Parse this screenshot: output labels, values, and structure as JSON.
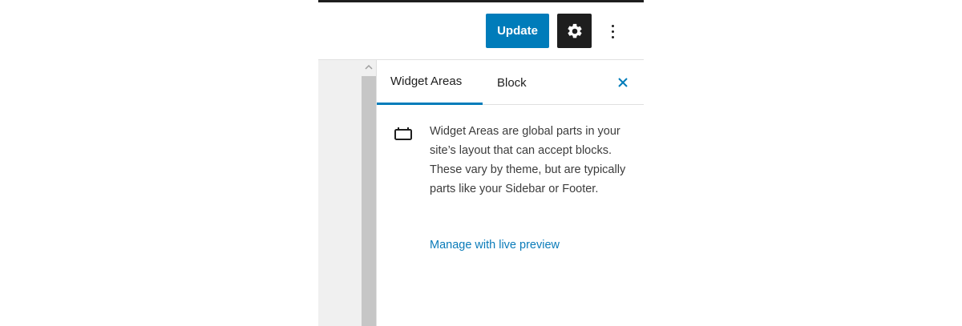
{
  "header": {
    "update_label": "Update",
    "settings_icon": "gear-icon",
    "more_icon": "more-vertical-icon"
  },
  "sidebar": {
    "tabs": [
      {
        "label": "Widget Areas",
        "active": true
      },
      {
        "label": "Block",
        "active": false
      }
    ],
    "close_icon": "close-icon",
    "panel": {
      "icon": "widget-area-icon",
      "description": "Widget Areas are global parts in your site’s layout that can accept blocks. These vary by theme, but are typically parts like your Sidebar or Footer.",
      "link_label": "Manage with live preview"
    }
  },
  "colors": {
    "accent": "#007cba",
    "dark": "#1e1e1e",
    "link": "#0a7bb9"
  }
}
